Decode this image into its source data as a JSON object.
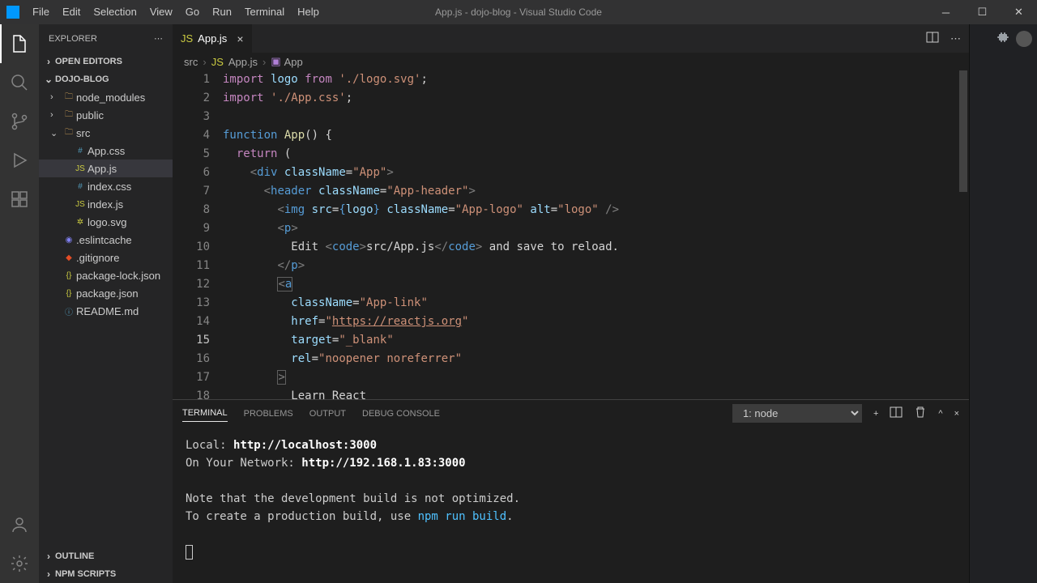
{
  "window": {
    "title": "App.js - dojo-blog - Visual Studio Code"
  },
  "menu": [
    "File",
    "Edit",
    "Selection",
    "View",
    "Go",
    "Run",
    "Terminal",
    "Help"
  ],
  "sidebar": {
    "title": "EXPLORER",
    "sections": {
      "openEditors": "OPEN EDITORS",
      "project": "DOJO-BLOG",
      "outline": "OUTLINE",
      "npmScripts": "NPM SCRIPTS"
    },
    "tree": [
      {
        "label": "node_modules",
        "type": "folder",
        "depth": 1,
        "expanded": false
      },
      {
        "label": "public",
        "type": "folder",
        "depth": 1,
        "expanded": false
      },
      {
        "label": "src",
        "type": "folder",
        "depth": 1,
        "expanded": true
      },
      {
        "label": "App.css",
        "type": "css",
        "depth": 2
      },
      {
        "label": "App.js",
        "type": "js",
        "depth": 2,
        "active": true
      },
      {
        "label": "index.css",
        "type": "css",
        "depth": 2
      },
      {
        "label": "index.js",
        "type": "js",
        "depth": 2
      },
      {
        "label": "logo.svg",
        "type": "svg",
        "depth": 2
      },
      {
        "label": ".eslintcache",
        "type": "eslint",
        "depth": 1
      },
      {
        "label": ".gitignore",
        "type": "git",
        "depth": 1
      },
      {
        "label": "package-lock.json",
        "type": "json",
        "depth": 1
      },
      {
        "label": "package.json",
        "type": "json",
        "depth": 1
      },
      {
        "label": "README.md",
        "type": "readme",
        "depth": 1
      }
    ]
  },
  "tabs": [
    {
      "label": "App.js",
      "icon": "js"
    }
  ],
  "breadcrumb": [
    "src",
    "App.js",
    "App"
  ],
  "editor": {
    "lineStart": 1,
    "lineEnd": 18,
    "currentLine": 15
  },
  "terminal": {
    "tabs": [
      "TERMINAL",
      "PROBLEMS",
      "OUTPUT",
      "DEBUG CONSOLE"
    ],
    "activeTab": "TERMINAL",
    "selector": "1: node",
    "localLabel": "Local:",
    "localUrl": "http://localhost:",
    "localPort": "3000",
    "networkLabel": "On Your Network:",
    "networkUrl": "http://192.168.1.83:",
    "networkPort": "3000",
    "note1": "Note that the development build is not optimized.",
    "note2a": "To create a production build, use ",
    "note2cmd": "npm run build",
    "note2b": "."
  }
}
